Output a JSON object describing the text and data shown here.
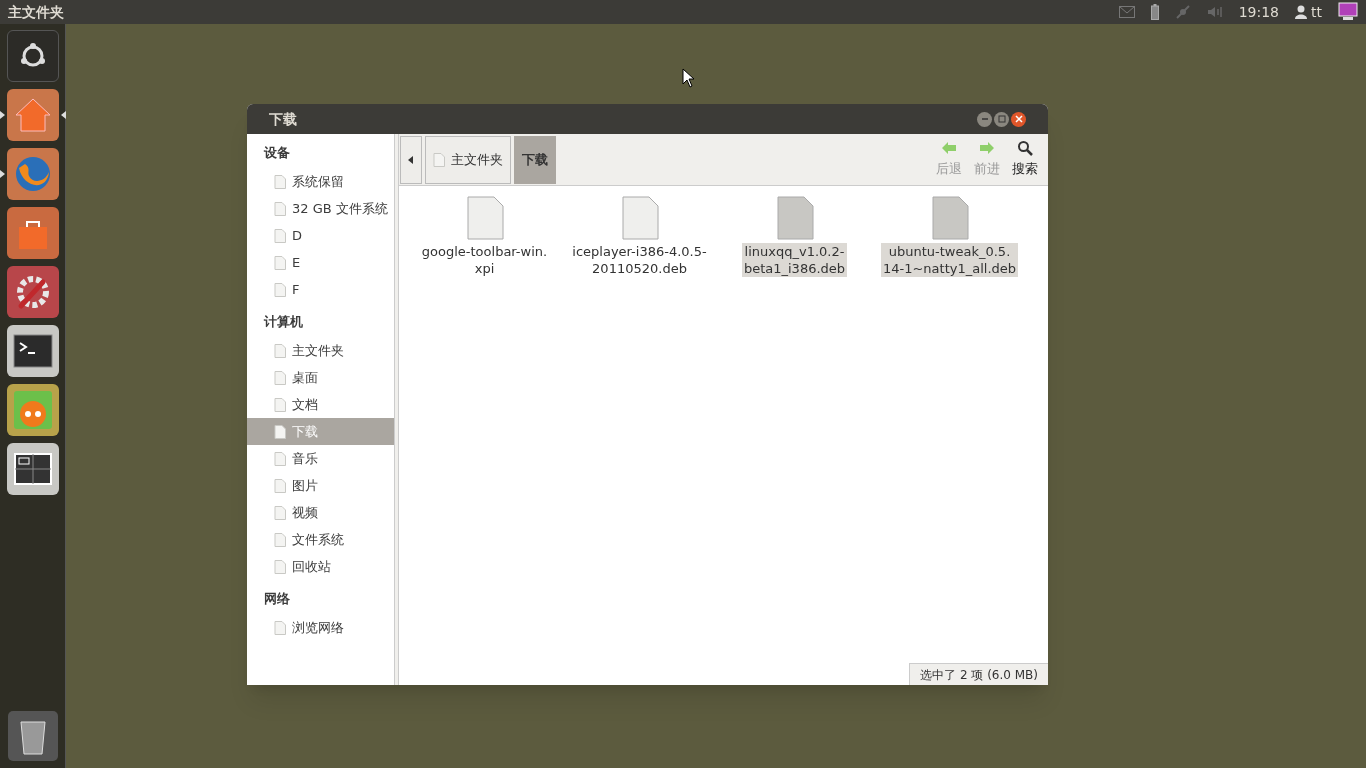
{
  "top_panel": {
    "title": "主文件夹",
    "clock": "19:18",
    "user": "tt"
  },
  "launcher": [
    {
      "kind": "dash",
      "running": false,
      "focused": false
    },
    {
      "kind": "home",
      "running": true,
      "focused": true
    },
    {
      "kind": "browser",
      "running": true,
      "focused": false
    },
    {
      "kind": "store",
      "running": false,
      "focused": false
    },
    {
      "kind": "settings",
      "running": false,
      "focused": false
    },
    {
      "kind": "terminal",
      "running": false,
      "focused": false
    },
    {
      "kind": "player",
      "running": false,
      "focused": false
    },
    {
      "kind": "workspaces",
      "running": false,
      "focused": false
    }
  ],
  "window": {
    "title": "下载",
    "sidebar": [
      {
        "heading": "设备",
        "items": [
          {
            "label": "系统保留",
            "selected": false
          },
          {
            "label": "32 GB 文件系统",
            "selected": false
          },
          {
            "label": "D",
            "selected": false
          },
          {
            "label": "E",
            "selected": false
          },
          {
            "label": "F",
            "selected": false
          }
        ]
      },
      {
        "heading": "计算机",
        "items": [
          {
            "label": "主文件夹",
            "selected": false
          },
          {
            "label": "桌面",
            "selected": false
          },
          {
            "label": "文档",
            "selected": false
          },
          {
            "label": "下载",
            "selected": true
          },
          {
            "label": "音乐",
            "selected": false
          },
          {
            "label": "图片",
            "selected": false
          },
          {
            "label": "视频",
            "selected": false
          },
          {
            "label": "文件系统",
            "selected": false
          },
          {
            "label": "回收站",
            "selected": false
          }
        ]
      },
      {
        "heading": "网络",
        "items": [
          {
            "label": "浏览网络",
            "selected": false
          }
        ]
      }
    ],
    "breadcrumb": [
      {
        "label": "主文件夹",
        "selected": false
      },
      {
        "label": "下载",
        "selected": true
      }
    ],
    "nav": [
      {
        "kind": "back",
        "label": "后退",
        "disabled": true
      },
      {
        "kind": "forward",
        "label": "前进",
        "disabled": true
      },
      {
        "kind": "search",
        "label": "搜索",
        "disabled": false
      }
    ],
    "files": [
      {
        "lines": [
          "google-toolbar-win.",
          "xpi"
        ],
        "selected": false
      },
      {
        "lines": [
          "iceplayer-i386-4.0.5-",
          "20110520.deb"
        ],
        "selected": false
      },
      {
        "lines": [
          "linuxqq_v1.0.2-",
          "beta1_i386.deb"
        ],
        "selected": true
      },
      {
        "lines": [
          "ubuntu-tweak_0.5.",
          "14-1~natty1_all.deb"
        ],
        "selected": true
      }
    ],
    "status": "选中了 2 项 (6.0 MB)"
  }
}
